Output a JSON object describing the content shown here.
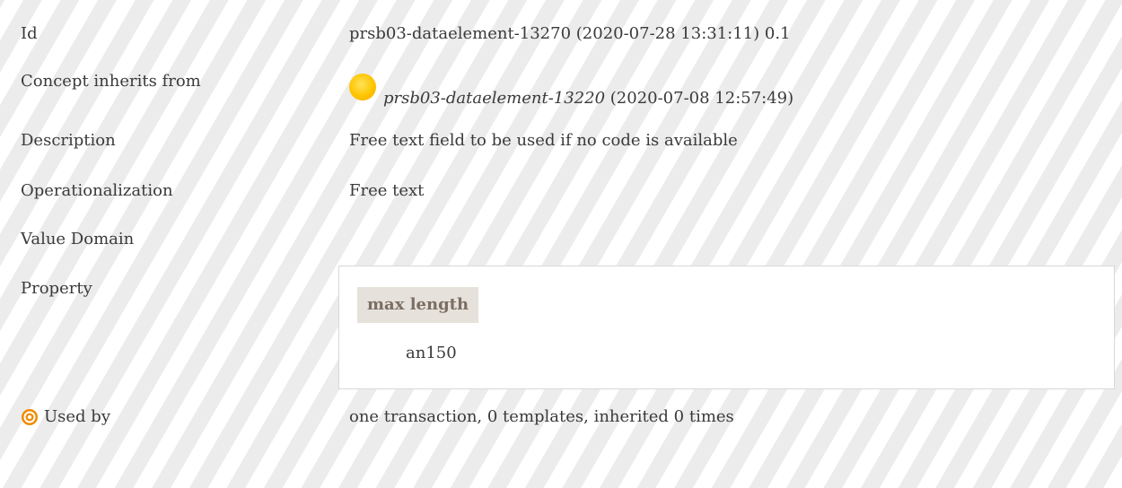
{
  "rows": {
    "id": {
      "label": "Id",
      "value": "prsb03-dataelement-13270 (2020-07-28 13:31:11) 0.1"
    },
    "inherits": {
      "label": "Concept inherits from",
      "link": "prsb03-dataelement-13220",
      "date": " (2020-07-08 12:57:49)",
      "icon": "sun-icon"
    },
    "description": {
      "label": "Description",
      "value": "Free text field to be used if no code is available"
    },
    "operationalization": {
      "label": "Operationalization",
      "value": "Free text"
    },
    "value_domain": {
      "label": "Value Domain"
    },
    "property": {
      "label": "Property",
      "header": "max length",
      "value": "an150"
    },
    "used_by": {
      "label": "Used by",
      "icon": "target-icon",
      "value": "one transaction, 0 templates, inherited 0 times"
    }
  },
  "colors": {
    "stripe": "#ececec",
    "property_header_bg": "#e6e1db",
    "property_header_text": "#7b6e63",
    "icon_orange": "#f08a00",
    "sun_yellow": "#ffc400"
  }
}
